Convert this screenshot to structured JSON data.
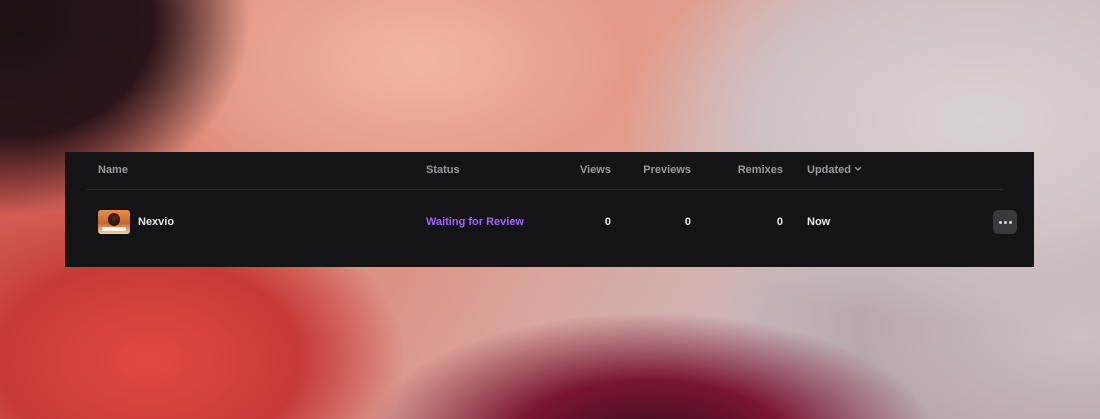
{
  "table": {
    "columns": {
      "name": "Name",
      "status": "Status",
      "views": "Views",
      "previews": "Previews",
      "remixes": "Remixes",
      "updated": "Updated"
    },
    "sort_icon": "chevron-down-icon",
    "rows": [
      {
        "thumbnail_icon": "project-thumbnail",
        "name": "Nexvio",
        "status": "Waiting for Review",
        "status_color": "#a562ff",
        "views": "0",
        "previews": "0",
        "remixes": "0",
        "updated": "Now",
        "actions_icon": "more-horizontal-icon"
      }
    ]
  },
  "colors": {
    "panel_bg": "#141316",
    "more_button_bg": "#3a393e",
    "header_text": "#9b9aa0",
    "row_text": "#e8e7ea"
  }
}
